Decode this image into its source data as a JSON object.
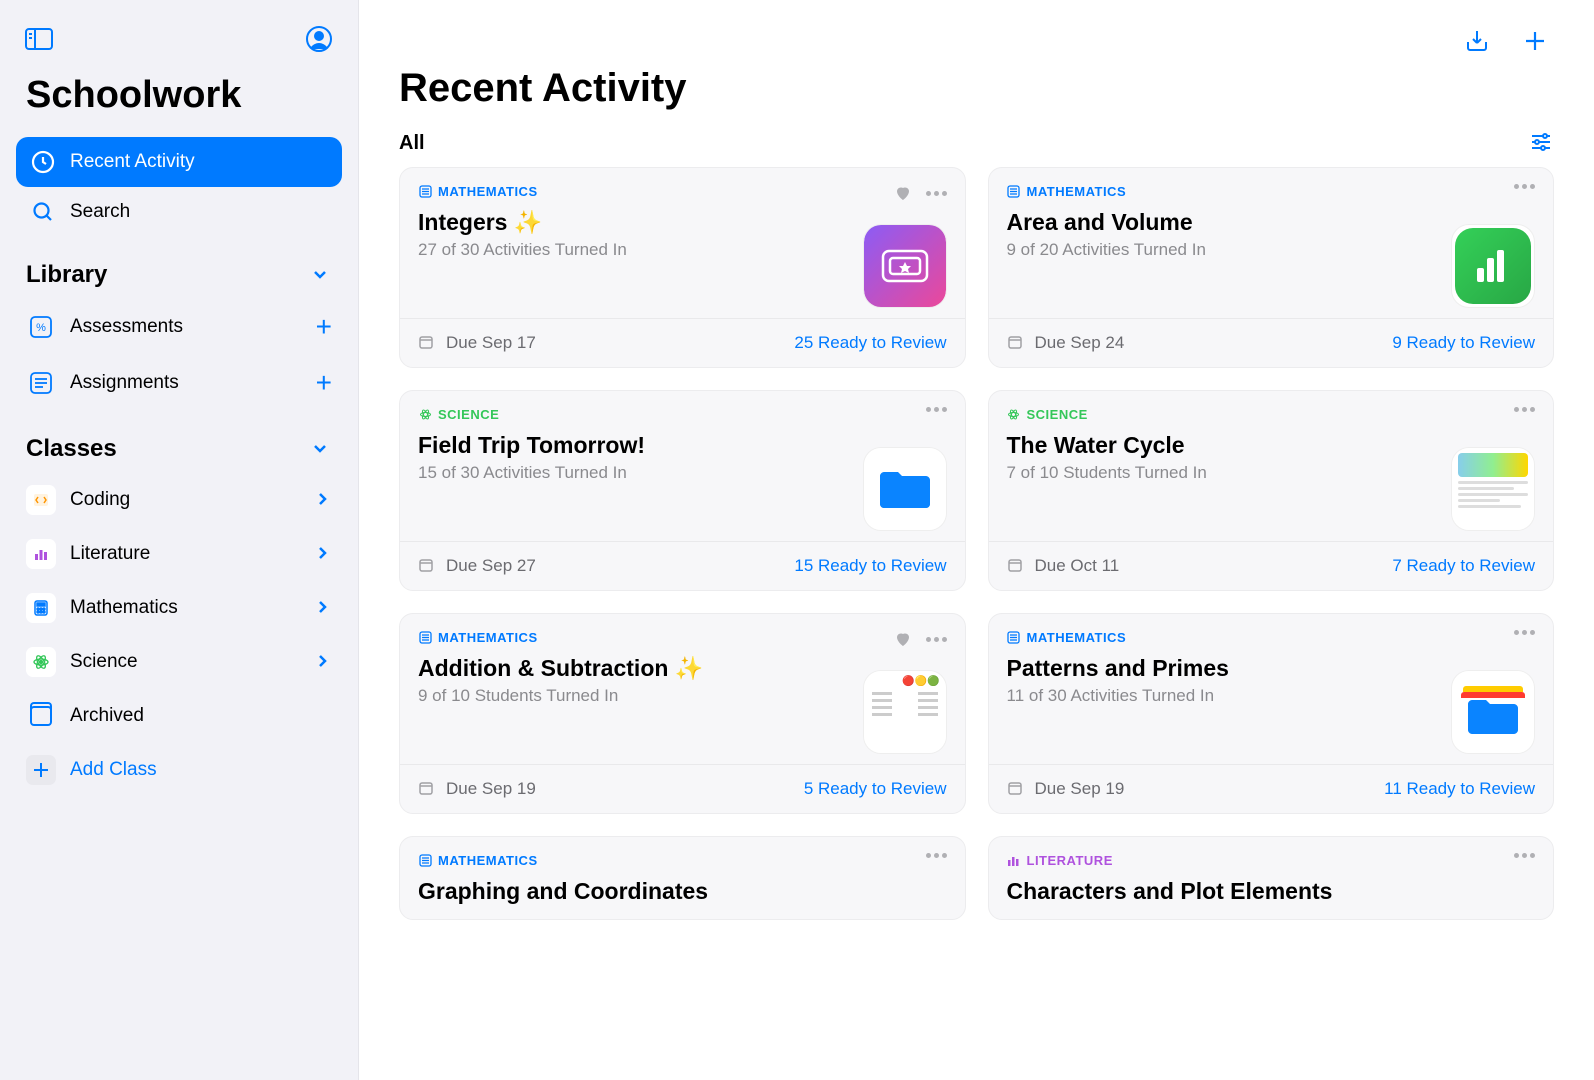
{
  "app_title": "Schoolwork",
  "nav": {
    "recent": "Recent Activity",
    "search": "Search"
  },
  "library": {
    "title": "Library",
    "assessments": "Assessments",
    "assignments": "Assignments"
  },
  "classes": {
    "title": "Classes",
    "items": [
      {
        "label": "Coding",
        "color": "#ff9500",
        "icon": "code"
      },
      {
        "label": "Literature",
        "color": "#af52de",
        "icon": "bars"
      },
      {
        "label": "Mathematics",
        "color": "#007aff",
        "icon": "calc"
      },
      {
        "label": "Science",
        "color": "#34c759",
        "icon": "atom"
      }
    ],
    "archived": "Archived",
    "add": "Add Class"
  },
  "page": {
    "title": "Recent Activity",
    "filter": "All"
  },
  "cards": [
    {
      "cat": "MATHEMATICS",
      "cat_class": "math",
      "title": "Integers ✨",
      "sub": "27 of 30 Activities Turned In",
      "heart": true,
      "thumb": "ticket",
      "due": "Due Sep 17",
      "ready": "25 Ready to Review"
    },
    {
      "cat": "MATHEMATICS",
      "cat_class": "math",
      "title": "Area and Volume",
      "sub": "9 of 20 Activities Turned In",
      "heart": false,
      "thumb": "charts",
      "due": "Due Sep 24",
      "ready": "9 Ready to Review"
    },
    {
      "cat": "SCIENCE",
      "cat_class": "science",
      "title": "Field Trip Tomorrow!",
      "sub": "15 of 30 Activities Turned In",
      "heart": false,
      "thumb": "folder",
      "due": "Due Sep 27",
      "ready": "15 Ready to Review"
    },
    {
      "cat": "SCIENCE",
      "cat_class": "science",
      "title": "The Water Cycle",
      "sub": "7 of 10 Students Turned In",
      "heart": false,
      "thumb": "doc",
      "due": "Due Oct 11",
      "ready": "7 Ready to Review"
    },
    {
      "cat": "MATHEMATICS",
      "cat_class": "math",
      "title": "Addition & Subtraction ✨",
      "sub": "9 of 10 Students Turned In",
      "heart": true,
      "thumb": "worksheet",
      "due": "Due Sep 19",
      "ready": "5 Ready to Review"
    },
    {
      "cat": "MATHEMATICS",
      "cat_class": "math",
      "title": "Patterns and Primes",
      "sub": "11 of 30 Activities Turned In",
      "heart": false,
      "thumb": "folder2",
      "due": "Due Sep 19",
      "ready": "11 Ready to Review"
    },
    {
      "cat": "MATHEMATICS",
      "cat_class": "math",
      "title": "Graphing and Coordinates",
      "sub": "",
      "partial": true
    },
    {
      "cat": "LITERATURE",
      "cat_class": "literature",
      "title": "Characters and Plot Elements",
      "sub": "",
      "partial": true
    }
  ]
}
